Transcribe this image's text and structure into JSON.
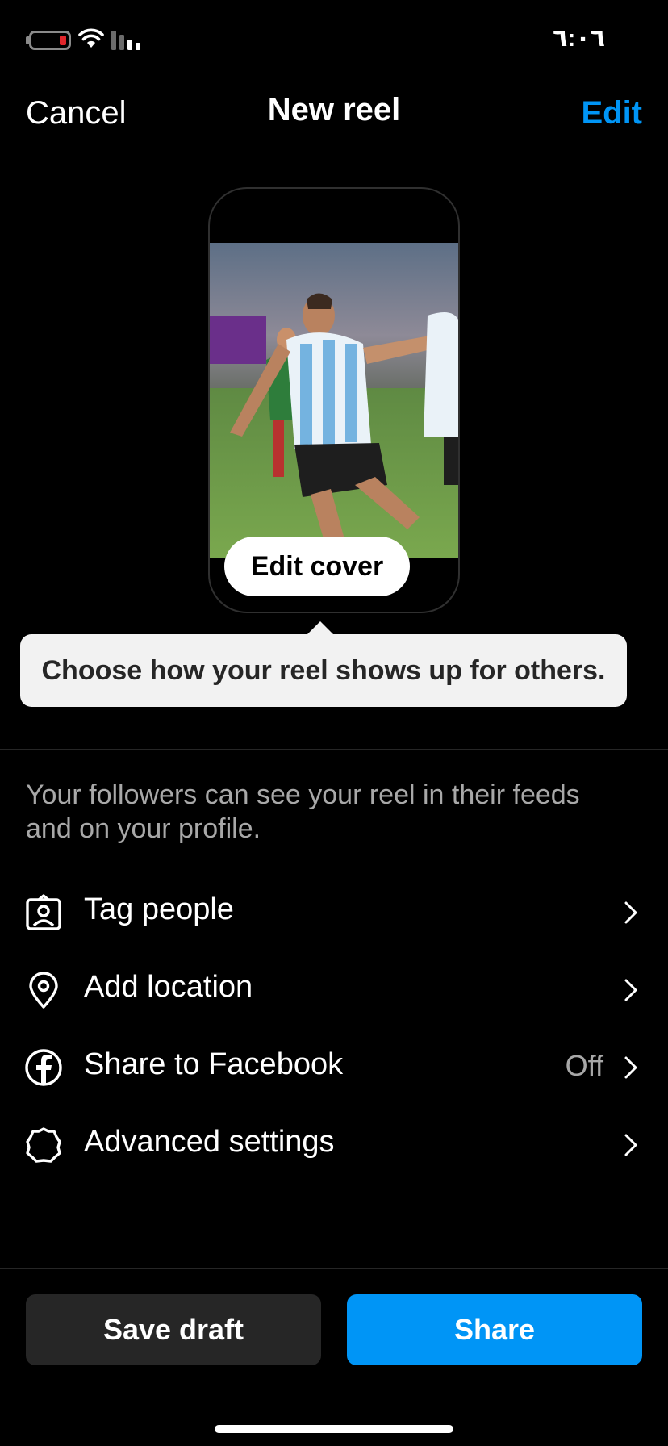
{
  "status_bar": {
    "time": "٦:٠٦",
    "battery_icon": "battery-low-icon",
    "wifi_icon": "wifi-icon",
    "signal_icon": "cellular-signal-icon",
    "battery_color": "#e0262b"
  },
  "header": {
    "cancel_label": "Cancel",
    "title": "New reel",
    "edit_label": "Edit"
  },
  "preview": {
    "image_alt": "reel cover photo",
    "edit_cover_label": "Edit cover"
  },
  "tooltip": {
    "text": "Choose how your reel shows up for others."
  },
  "info_text": "Your followers can see your reel in their feeds and on your profile.",
  "options": [
    {
      "label": "Tag people",
      "icon": "tag-people-icon",
      "value": ""
    },
    {
      "label": "Add location",
      "icon": "location-pin-icon",
      "value": ""
    },
    {
      "label": "Share to Facebook",
      "icon": "facebook-icon",
      "value": "Off"
    },
    {
      "label": "Advanced settings",
      "icon": "gear-icon",
      "value": ""
    }
  ],
  "footer": {
    "save_draft_label": "Save draft",
    "share_label": "Share"
  },
  "colors": {
    "accent": "#0095f6",
    "background": "#000000",
    "secondary_text": "#a8a8a8"
  }
}
